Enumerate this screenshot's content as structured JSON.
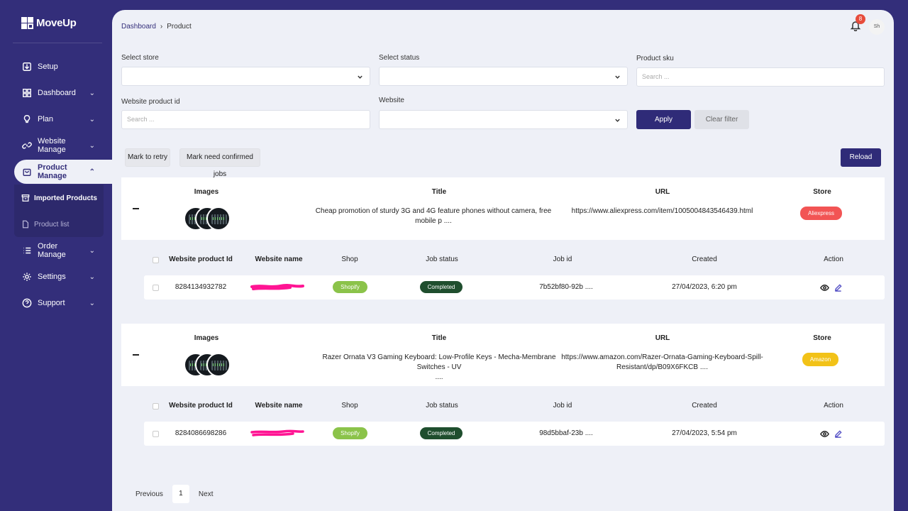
{
  "app": {
    "name": "MoveUp"
  },
  "sidebar": {
    "items": [
      {
        "label": "Setup",
        "icon": "download-icon"
      },
      {
        "label": "Dashboard",
        "icon": "grid-icon"
      },
      {
        "label": "Plan",
        "icon": "lightbulb-icon"
      },
      {
        "label": "Website Manage",
        "icon": "link-icon"
      },
      {
        "label": "Product Manage",
        "icon": "bag-icon"
      },
      {
        "label": "Order Manage",
        "icon": "list-icon"
      },
      {
        "label": "Settings",
        "icon": "gear-icon"
      },
      {
        "label": "Support",
        "icon": "help-icon"
      }
    ],
    "submenu": [
      {
        "label": "Imported Products",
        "icon": "box-icon"
      },
      {
        "label": "Product list",
        "icon": "file-icon"
      }
    ]
  },
  "header": {
    "breadcrumb": [
      "Dashboard",
      "Product"
    ],
    "notifications_count": "8",
    "avatar_text": "Sh"
  },
  "filters": {
    "store_label": "Select store",
    "status_label": "Select status",
    "sku_label": "Product sku",
    "sku_placeholder": "Search ...",
    "website_product_id_label": "Website product id",
    "website_product_id_placeholder": "Search ...",
    "website_label": "Website",
    "apply_label": "Apply",
    "clear_label": "Clear filter"
  },
  "actions": {
    "mark_retry": "Mark to retry",
    "mark_confirmed": "Mark need confirmed jobs",
    "reload": "Reload"
  },
  "product_columns": [
    "Images",
    "Title",
    "URL",
    "Store"
  ],
  "job_columns": [
    "Website product Id",
    "Website name",
    "Shop",
    "Job status",
    "Job id",
    "Created",
    "Action"
  ],
  "products": [
    {
      "title": "Cheap promotion of sturdy 3G and 4G feature phones without camera, free mobile p ....",
      "url": "https://www.aliexpress.com/item/1005004843546439.html",
      "store": "Aliexpress",
      "store_color": "#f25454",
      "job": {
        "website_product_id": "8284134932782",
        "shop": "Shopify",
        "status": "Completed",
        "job_id": "7b52bf80-92b ....",
        "created": "27/04/2023, 6:20 pm"
      }
    },
    {
      "title_line1": "Razer Ornata V3 Gaming Keyboard: Low-Profile Keys - Mecha-Membrane Switches - UV",
      "title_line2": "....",
      "url_line1": "https://www.amazon.com/Razer-Ornata-Gaming-Keyboard-Spill-",
      "url_line2": "Resistant/dp/B09X6FKCB ....",
      "store": "Amazon",
      "store_color": "#f2c218",
      "job": {
        "website_product_id": "8284086698286",
        "shop": "Shopify",
        "status": "Completed",
        "job_id": "98d5bbaf-23b ....",
        "created": "27/04/2023, 5:54 pm"
      }
    }
  ],
  "pagination": {
    "previous": "Previous",
    "current": "1",
    "next": "Next"
  }
}
